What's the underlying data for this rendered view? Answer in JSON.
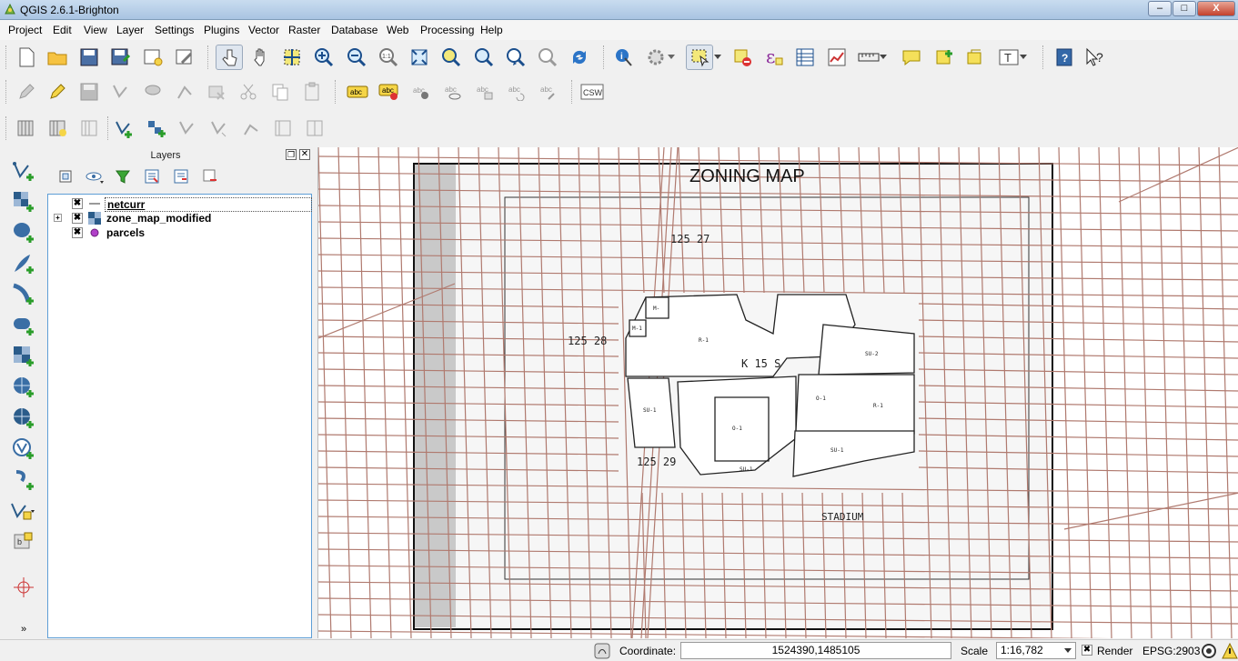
{
  "window": {
    "title": "QGIS 2.6.1-Brighton",
    "min": "–",
    "max": "□",
    "close": "X"
  },
  "menu": [
    "Project",
    "Edit",
    "View",
    "Layer",
    "Settings",
    "Plugins",
    "Vector",
    "Raster",
    "Database",
    "Web",
    "Processing",
    "Help"
  ],
  "toolbar": {
    "csw_label": "CSW",
    "abc_label": "abc"
  },
  "layers_panel": {
    "title": "Layers"
  },
  "layers": [
    {
      "name": "netcurr",
      "checked": "✖"
    },
    {
      "name": "zone_map_modified",
      "checked": "✖"
    },
    {
      "name": "parcels",
      "checked": "✖"
    }
  ],
  "map": {
    "title": "ZONING MAP",
    "labels": {
      "l1": "125 27",
      "l2": "125 28",
      "l3": "K 15 S",
      "l4": "125 29",
      "l5": "STADIUM",
      "z1": "R-1",
      "z2": "SU-2",
      "z3": "SU-1",
      "z4": "O-1",
      "z5": "O-1",
      "z6": "R-1",
      "z7": "SU-1",
      "z8": "SU-1",
      "z9": "M-1",
      "z10": "M-"
    },
    "line_color": "#b07a6f"
  },
  "status": {
    "coordinate_label": "Coordinate:",
    "coordinate": "1524390,1485105",
    "scale_label": "Scale",
    "scale": "1:16,782",
    "render_label": "Render",
    "render_check": "✖",
    "epsg": "EPSG:2903"
  }
}
